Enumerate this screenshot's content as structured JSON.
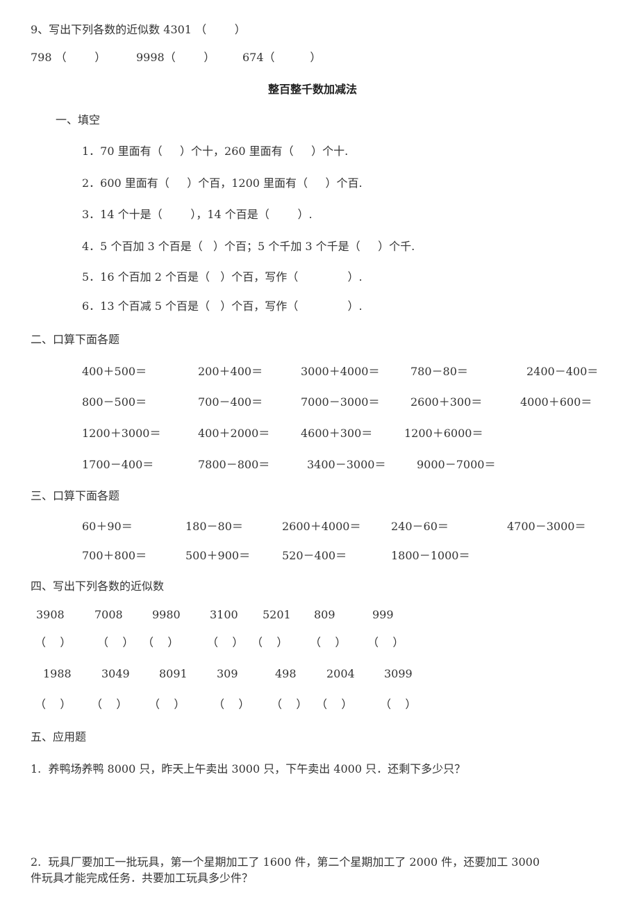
{
  "header": {
    "q9_line": "9、写出下列各数的近似数 4301 （        ）",
    "q9_items": [
      "798 （        ）",
      "9998（        ）",
      "674（          ）"
    ]
  },
  "title": "整百整千数加减法",
  "section1": {
    "heading": "一、填空",
    "items": [
      "1．70 里面有（     ）个十，260 里面有（     ）个十.",
      "2．600 里面有（     ）个百，1200 里面有（     ）个百.",
      "3．14 个十是（        ），14 个百是（        ）.",
      "4．5 个百加 3 个百是（   ）个百；5 个千加 3 个千是（     ）个千.",
      "5．16 个百加 2 个百是（   ）个百，写作（              ）.",
      "6．13 个百减 5 个百是（   ）个百，写作（              ）."
    ]
  },
  "section2": {
    "heading": "二、口算下面各题",
    "rows": [
      [
        "400＋500＝",
        "200＋400＝",
        "3000＋4000＝",
        "780－80＝",
        "2400－400＝"
      ],
      [
        "800－500＝",
        "700－400＝",
        "7000－3000＝",
        "2600＋300＝",
        "4000＋600＝"
      ],
      [
        "1200＋3000＝",
        "400＋2000＝",
        "4600＋300＝",
        "1200＋6000＝"
      ],
      [
        "1700－400＝",
        "7800－800＝",
        "3400－3000＝",
        "9000－7000＝"
      ]
    ]
  },
  "section3": {
    "heading": "三、口算下面各题",
    "rows": [
      [
        "60＋90＝",
        "180－80＝",
        "2600＋4000＝",
        "240－60＝",
        "4700－3000＝"
      ],
      [
        "700＋800＝",
        "500＋900＝",
        "520－400＝",
        "1800－1000＝"
      ]
    ]
  },
  "section4": {
    "heading": "四、写出下列各数的近似数",
    "row1_numbers": [
      "3908",
      "7008",
      "9980",
      "3100",
      "5201",
      "809",
      "999"
    ],
    "row2_numbers": [
      "1988",
      "3049",
      "8091",
      "309",
      "498",
      "2004",
      "3099"
    ],
    "blank": "（    ）"
  },
  "section5": {
    "heading": "五、应用题",
    "problems": [
      "1.  养鸭场养鸭 8000 只，昨天上午卖出 3000 只，下午卖出 4000 只．还剩下多少只？",
      "2.  玩具厂要加工一批玩具，第一个星期加工了 1600 件，第二个星期加工了 2000 件，还要加工 3000",
      "件玩具才能完成任务．共要加工玩具多少件？"
    ]
  }
}
